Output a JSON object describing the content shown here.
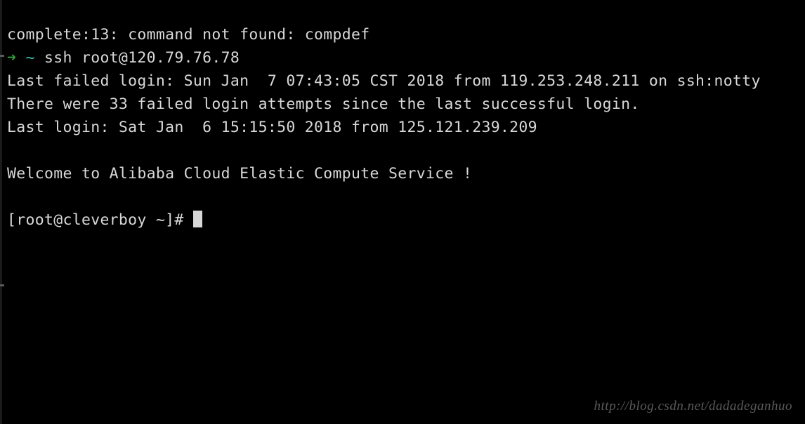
{
  "terminal": {
    "line1": "complete:13: command not found: compdef",
    "prompt_arrow": "➜",
    "prompt_tilde": " ~ ",
    "ssh_command": "ssh root@120.79.76.78",
    "line3": "Last failed login: Sun Jan  7 07:43:05 CST 2018 from 119.253.248.211 on ssh:notty",
    "line4": "There were 33 failed login attempts since the last successful login.",
    "line5": "Last login: Sat Jan  6 15:15:50 2018 from 125.121.239.209",
    "blank": "",
    "line7": "Welcome to Alibaba Cloud Elastic Compute Service !",
    "prompt2": "[root@cleverboy ~]# "
  },
  "watermark": "http://blog.csdn.net/dadadeganhuo"
}
